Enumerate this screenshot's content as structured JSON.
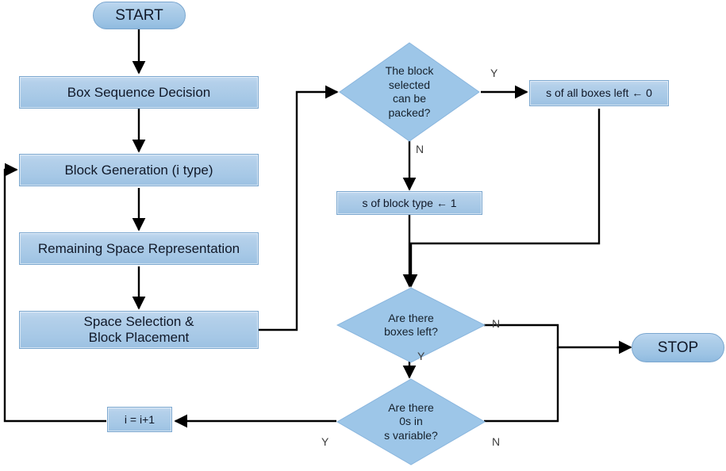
{
  "diagram": {
    "title": "Box Packing Algorithm Flowchart",
    "type": "flowchart",
    "colors": {
      "node_fill_top": "#c2d9f0",
      "node_fill_bottom": "#9cc1e2",
      "node_border": "#7ba7cf",
      "decision_fill": "#9dc6e8",
      "decision_border": "#8ab6de",
      "edge": "#000000",
      "text": "#101828",
      "edge_label_text": "#3d3d3d",
      "background": "#ffffff"
    }
  },
  "nodes": {
    "start": {
      "label": "START",
      "shape": "terminator"
    },
    "box_sequence_decision": {
      "label": "Box Sequence Decision",
      "shape": "process"
    },
    "block_generation": {
      "label": "Block Generation (i type)",
      "shape": "process"
    },
    "remaining_space": {
      "label": "Remaining Space Representation",
      "shape": "process"
    },
    "space_selection": {
      "label": "Space Selection &\nBlock Placement",
      "shape": "process"
    },
    "can_be_packed": {
      "label": "The block\nselected\ncan be\npacked?",
      "shape": "decision"
    },
    "s_all_boxes_left": {
      "label": "s of all boxes left ← 0",
      "shape": "process"
    },
    "s_block_type": {
      "label": "s of block type ← 1",
      "shape": "process"
    },
    "boxes_left": {
      "label": "Are there\nboxes left?",
      "shape": "decision"
    },
    "zeros_in_s": {
      "label": "Are there\n0s in\ns variable?",
      "shape": "decision"
    },
    "increment_i": {
      "label": "i = i+1",
      "shape": "process"
    },
    "stop": {
      "label": "STOP",
      "shape": "terminator"
    }
  },
  "edge_labels": {
    "packed_yes": "Y",
    "packed_no": "N",
    "boxes_left_no": "N",
    "boxes_left_yes": "Y",
    "zeros_yes": "Y",
    "zeros_no": "N"
  }
}
